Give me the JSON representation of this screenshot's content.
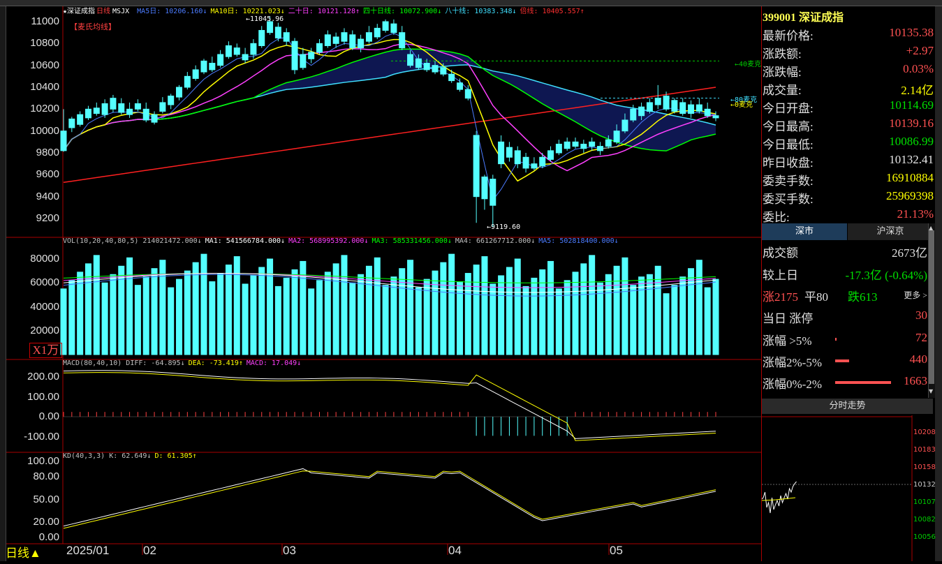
{
  "chart_title": {
    "star": "★",
    "name": "深证成指",
    "period": "日线",
    "indicator": "MSJX"
  },
  "ma_legend": [
    {
      "text": "MA5日: 10206.160↓",
      "color": "#4c7cff"
    },
    {
      "text": "MA10日: 10221.023↓",
      "color": "#ffff00"
    },
    {
      "text": "二十日: 10121.128↑",
      "color": "#ff40ff"
    },
    {
      "text": "四十日线: 10072.900↓",
      "color": "#00ff00"
    },
    {
      "text": "八十线: 10383.348↓",
      "color": "#40e0ff"
    },
    {
      "text": "倍线: 10405.557↑",
      "color": "#ff3030"
    }
  ],
  "maishi_label": "【麦氏均线】",
  "price_axis": [
    "11000",
    "10800",
    "10600",
    "10400",
    "10200",
    "10000",
    "9800",
    "9600",
    "9400",
    "9200"
  ],
  "annotations": {
    "high": "11045.96",
    "low": "9119.60",
    "line40": "40麦克",
    "line80": "80麦克",
    "line_b": "0麦克"
  },
  "vol_legend": [
    {
      "text": "VOL(10,20,40,80,5) 214021472.000↓",
      "color": "#c0c0c0"
    },
    {
      "text": "MA1: 541566784.000↓",
      "color": "#ffffff"
    },
    {
      "text": "MA2: 568995392.000↓",
      "color": "#ff40ff"
    },
    {
      "text": "MA3: 585331456.000↓",
      "color": "#00ff00"
    },
    {
      "text": "MA4: 661267712.000↓",
      "color": "#c0c0c0"
    },
    {
      "text": "MA5: 502818400.000↓",
      "color": "#4c7cff"
    }
  ],
  "vol_axis": [
    "80000",
    "60000",
    "40000",
    "20000"
  ],
  "vol_unit": "X1万",
  "macd_legend": [
    {
      "text": "MACD(80,40,10) DIFF: -64.895↓",
      "color": "#c0c0c0"
    },
    {
      "text": "DEA: -73.419↑",
      "color": "#ffff00"
    },
    {
      "text": "MACD: 17.049↓",
      "color": "#ff40ff"
    }
  ],
  "macd_axis": [
    "200.00",
    "100.00",
    "0.00",
    "-100.00"
  ],
  "kd_legend": [
    {
      "text": "KD(40,3,3) K: 62.649↓",
      "color": "#c0c0c0"
    },
    {
      "text": "D: 61.305↑",
      "color": "#ffff00"
    }
  ],
  "kd_axis": [
    "100.00",
    "80.00",
    "50.00",
    "20.00",
    "0.00"
  ],
  "x_axis": [
    "2025/01",
    "02",
    "03",
    "04",
    "05"
  ],
  "period_label": "日线▲",
  "quote": {
    "symbol_code": "399001",
    "symbol_name": "深证成指",
    "rows": [
      {
        "label": "最新价格:",
        "value": "10135.38",
        "color": "red"
      },
      {
        "label": "涨跌额:",
        "value": "+2.97",
        "color": "red"
      },
      {
        "label": "涨跌幅:",
        "value": "0.03%",
        "color": "red"
      },
      {
        "label": "成交量:",
        "value": "2.14亿",
        "color": "yellow"
      },
      {
        "label": "今日开盘:",
        "value": "10114.69",
        "color": "green"
      },
      {
        "label": "今日最高:",
        "value": "10139.16",
        "color": "red"
      },
      {
        "label": "今日最低:",
        "value": "10086.99",
        "color": "green"
      },
      {
        "label": "昨日收盘:",
        "value": "10132.41",
        "color": "white"
      },
      {
        "label": "委卖手数:",
        "value": "16910884",
        "color": "yellow"
      },
      {
        "label": "委买手数:",
        "value": "25969398",
        "color": "yellow"
      },
      {
        "label": "委比:",
        "value": "21.13%",
        "color": "red"
      }
    ]
  },
  "tabs": [
    "深市",
    "沪深京"
  ],
  "market_stats": {
    "turnover_label": "成交额",
    "turnover_value": "2673亿",
    "vs_label": "较上日",
    "vs_value": "-17.3亿 (-0.64%)",
    "up_label": "涨2175",
    "flat_label": "平80",
    "down_label": "跌613",
    "more_label": "更多 >",
    "limit_up_label": "当日 涨停",
    "limit_up_value": "30",
    "gt5_label": "涨幅 >5%",
    "gt5_value": "72",
    "r25_label": "涨幅2%-5%",
    "r25_value": "440",
    "r02_label": "涨幅0%-2%",
    "r02_value": "1663"
  },
  "intraday": {
    "title": "分时走势",
    "axis": [
      "10208",
      "10183",
      "10158",
      "10132",
      "10107",
      "10082",
      "10056"
    ]
  }
}
